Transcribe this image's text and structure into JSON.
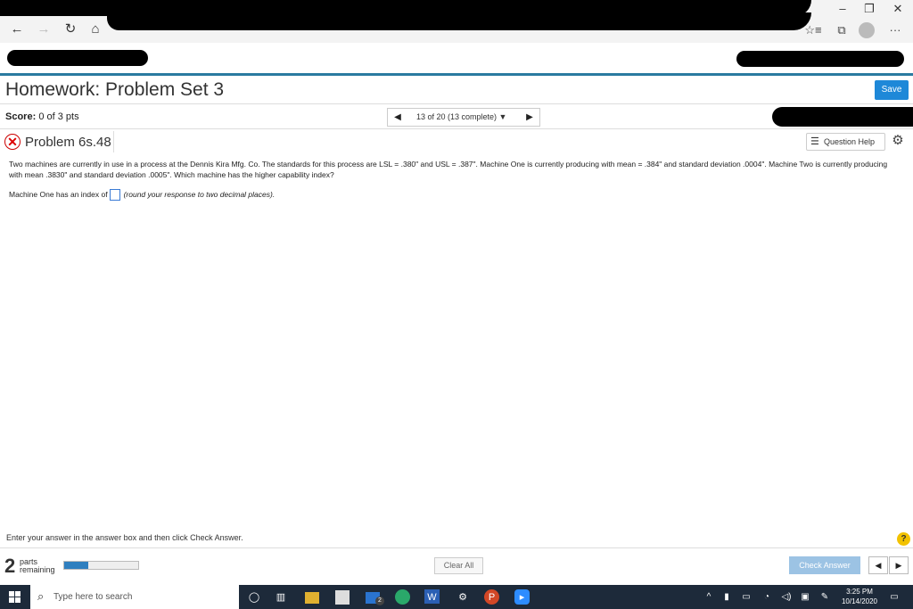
{
  "browser": {
    "back_glyph": "←",
    "forward_glyph": "→",
    "refresh_glyph": "↻",
    "home_glyph": "⌂",
    "minimize_glyph": "–",
    "restore_glyph": "❐",
    "close_glyph": "✕",
    "favorites_glyph": "☆≡",
    "collections_glyph": "⧉",
    "more_glyph": "···"
  },
  "header": {
    "title": "Homework: Problem Set 3",
    "save_label": "Save"
  },
  "score": {
    "label": "Score:",
    "value": "0 of 3 pts"
  },
  "pager": {
    "text": "13 of 20 (13 complete) ▼",
    "prev_glyph": "◀",
    "next_glyph": "▶"
  },
  "problem": {
    "status_glyph": "✕",
    "title": "Problem 6s.48",
    "help_glyph": "☰",
    "help_label": "Question Help",
    "gear_glyph": "⚙",
    "question_text": "Two machines are currently in use in a process at the Dennis Kira Mfg. Co. The standards for this process are LSL = .380\" and USL = .387\". Machine One is currently producing with mean = .384\" and standard deviation .0004\". Machine Two is currently producing with mean .3830\" and standard deviation .0005\". Which machine has the higher capability index?",
    "answer_prefix": "Machine One has an index of",
    "answer_value": "",
    "answer_hint": "(round your response to two decimal places)."
  },
  "footer": {
    "instruction": "Enter your answer in the answer box and then click Check Answer.",
    "help_glyph": "?",
    "parts_count": "2",
    "parts_label_1": "parts",
    "parts_label_2": "remaining",
    "progress_fraction": 0.33,
    "clear_all_label": "Clear All",
    "check_answer_label": "Check Answer",
    "prev_glyph": "◀",
    "next_glyph": "▶"
  },
  "taskbar": {
    "search_glyph": "⌕",
    "search_placeholder": "Type here to search",
    "time": "3:25 PM",
    "date": "10/14/2020",
    "badge": "2",
    "icons": [
      "task-view-icon",
      "file-explorer-icon",
      "store-icon",
      "mail-icon",
      "edge-icon",
      "word-icon",
      "settings-icon",
      "powerpoint-icon",
      "zoom-icon"
    ],
    "tray_glyphs": [
      "^",
      "▮",
      "▭",
      "◔",
      "◁)",
      "▣",
      "✎",
      "▭"
    ]
  },
  "colors": {
    "accent": "#1e88d8",
    "header_line": "#2a7aa0",
    "error": "#dd0000",
    "taskbar": "#1d2a3a"
  }
}
